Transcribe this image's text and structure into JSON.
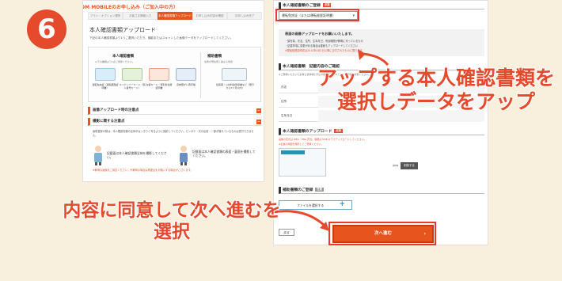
{
  "step_number": "6",
  "left_screen": {
    "brand": "J:COM MOBILEのお申し込み（ご加入中の方）",
    "steps": [
      {
        "label": "プラン・オプション選択",
        "active": false
      },
      {
        "label": "お客さま情報入力",
        "active": false
      },
      {
        "label": "本人確認書類アップロード",
        "active": true
      },
      {
        "label": "お申し込み内容の確認",
        "active": false
      },
      {
        "label": "お申し込み完了",
        "active": false
      }
    ],
    "page_title": "本人確認書類アップロード",
    "description": "下記の本人確認書類より1つご選択いただき、撮影またはスキャンした画像データをアップロードしてください。",
    "doc_heading": "本人確認書類",
    "doc_sub": "以下の書類より1点ご用意ください。",
    "supp_heading": "補助書類",
    "supp_sub": "住所が現住所と異なる場合",
    "doc_cards": [
      {
        "caption": "運転免許証（運転経歴証明書）",
        "color": "#d9ecf7"
      },
      {
        "caption": "マイナンバーカード（個人番号カード）",
        "color": "#e6f1dc"
      },
      {
        "caption": "在留カード・特別永住者証明書",
        "color": "#fde6dc"
      },
      {
        "caption": "身体障がい者手帳",
        "color": "#e5eef8"
      }
    ],
    "supp_caption": "住民票・公共料金領収書など（発行から3ヶ月以内）",
    "sections": [
      {
        "label": "画像アップロード時の注意点"
      },
      {
        "label": "撮影に関する注意点"
      }
    ],
    "notes": "画像登録の際は、本人確認書類の全体がはっきりと写るように撮影してください。ピンボケ・光の反射・一部が隠れているものは受付できません。",
    "speech_left": "記載面は本人確認書類全体を撮影してください。",
    "speech_right": "記載面は本人確認書類の表面・裏面を撮影してください。",
    "warning": "※鮮明な画像をご用意ください。不鮮明な場合は再提出をお願いする場合がございます。"
  },
  "right_screen": {
    "select_heading": "本人確認書類のご登録",
    "required_badge": "必須",
    "select_value": "運転免許証（または運転経歴証明書）",
    "select_chevron": "▾",
    "info_title": "表面の画像アップロードをお願いいたします。",
    "info_lines": [
      "・顔写真、氏名、住所、生年月日、有効期限が鮮明に写っているもの",
      "・記載事項に変更がある場合は裏面もアップロードしてください",
      "※運転経歴証明書は2012年4月1日以降に交付されたものに限ります"
    ],
    "confirm_heading": "本人確認書類　記載内容のご確認",
    "confirm_note": "※ご登録いただいたお客さま情報と同じ内容が記載されている書類をご用意ください。",
    "rows": [
      {
        "label": "氏名"
      },
      {
        "label": "住所"
      },
      {
        "label": "生年月日"
      }
    ],
    "upload_heading": "本人確認書類のアップロード",
    "upload_note_1": "画像の形式は JPEG・PNG 形式、容量は 5MB 以下でアップロードしてください。",
    "upload_note_2": "※表裏の両面を撮影してご登録ください。",
    "file_name": "jpeg",
    "upload_button": "削除する",
    "supp_heading": "補助書類のご登録",
    "supp_badge": "任意",
    "file_select_button": "ファイルを選択する",
    "file_plus": "+",
    "back_button": "戻る",
    "next_button": "次へ進む",
    "next_arrow": "›"
  },
  "captions": {
    "upload_caption": "アップする本人確認書類を選択しデータをアップ",
    "agree_caption": "内容に同意して次へ進むを選択"
  },
  "colors": {
    "accent": "#e54a2d",
    "background": "#f8efdc"
  }
}
